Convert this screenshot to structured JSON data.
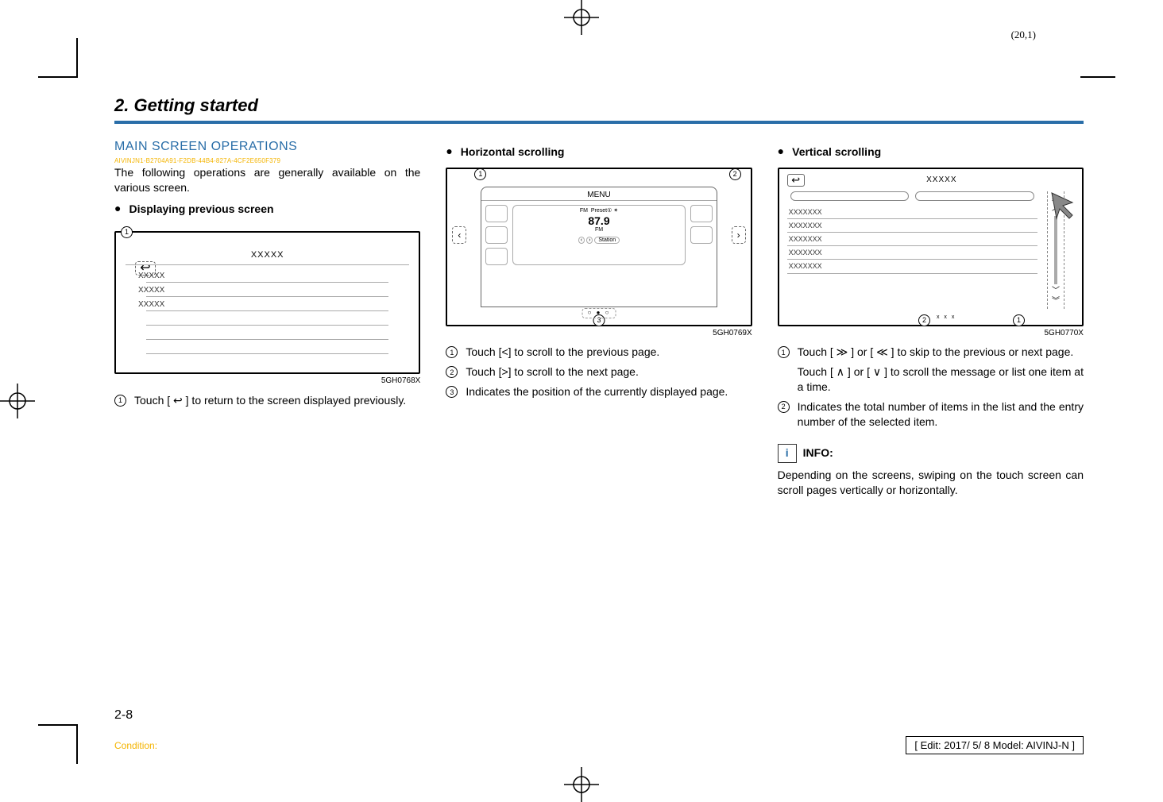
{
  "page_number_top": "(20,1)",
  "chapter_title": "2. Getting started",
  "section_title": "MAIN SCREEN OPERATIONS",
  "section_code": "AIVINJN1-B2704A91-F2DB-44B4-827A-4CF2E650F379",
  "intro": "The following operations are generally available on the various screen.",
  "col1": {
    "bullet": "Displaying previous screen",
    "fig": {
      "title": "XXXXX",
      "rows": [
        "XXXXX",
        "XXXXX",
        "XXXXX"
      ],
      "caption": "5GH0768X"
    },
    "items": {
      "1": "Touch [ ↩ ] to return to the screen displayed previously."
    }
  },
  "col2": {
    "bullet": "Horizontal scrolling",
    "fig": {
      "menu": "MENU",
      "fm": "FM",
      "preset": "Preset①",
      "freq": "87.9",
      "fmlabel": "FM",
      "station": "Station",
      "caption": "5GH0769X"
    },
    "items": {
      "1": "Touch [<] to scroll to the previous page.",
      "2": "Touch [>] to scroll to the next page.",
      "3": "Indicates the position of the currently displayed page."
    }
  },
  "col3": {
    "bullet": "Vertical scrolling",
    "fig": {
      "title": "XXXXX",
      "rows": [
        "XXXXXXX",
        "XXXXXXX",
        "XXXXXXX",
        "XXXXXXX",
        "XXXXXXX"
      ],
      "pager": "x x x",
      "caption": "5GH0770X"
    },
    "items": {
      "1": "Touch [ ≫ ] or [ ≪ ] to skip to the previous or next page.",
      "1b": "Touch [ ∧ ] or [ ∨ ] to scroll the message or list one item at a time.",
      "2": "Indicates the total number of items in the list and the entry number of the selected item."
    },
    "info_label": "INFO:",
    "info_text": "Depending on the screens, swiping on the touch screen can scroll pages vertically or horizontally."
  },
  "footer": {
    "page": "2-8",
    "condition": "Condition:",
    "edit": "[ Edit: 2017/ 5/ 8    Model:  AIVINJ-N ]"
  },
  "callouts": {
    "c1": "1",
    "c2": "2",
    "c3": "3"
  }
}
